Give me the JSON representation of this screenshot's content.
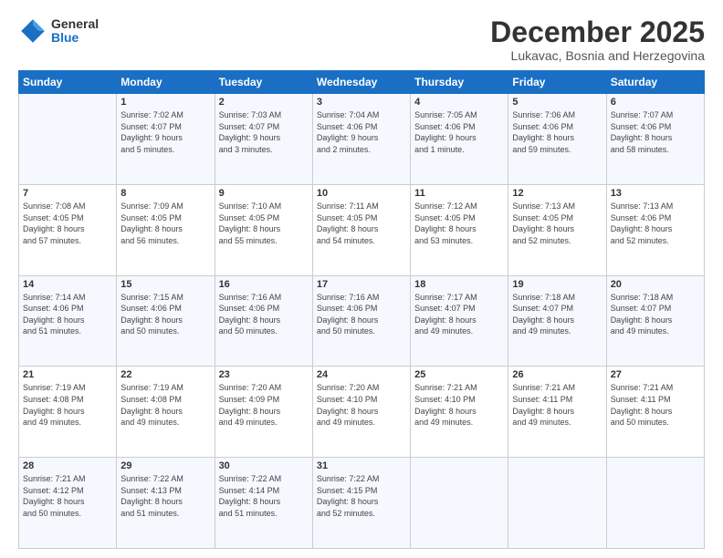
{
  "logo": {
    "general": "General",
    "blue": "Blue"
  },
  "title": "December 2025",
  "subtitle": "Lukavac, Bosnia and Herzegovina",
  "days": [
    "Sunday",
    "Monday",
    "Tuesday",
    "Wednesday",
    "Thursday",
    "Friday",
    "Saturday"
  ],
  "weeks": [
    [
      {
        "num": "",
        "info": ""
      },
      {
        "num": "1",
        "info": "Sunrise: 7:02 AM\nSunset: 4:07 PM\nDaylight: 9 hours\nand 5 minutes."
      },
      {
        "num": "2",
        "info": "Sunrise: 7:03 AM\nSunset: 4:07 PM\nDaylight: 9 hours\nand 3 minutes."
      },
      {
        "num": "3",
        "info": "Sunrise: 7:04 AM\nSunset: 4:06 PM\nDaylight: 9 hours\nand 2 minutes."
      },
      {
        "num": "4",
        "info": "Sunrise: 7:05 AM\nSunset: 4:06 PM\nDaylight: 9 hours\nand 1 minute."
      },
      {
        "num": "5",
        "info": "Sunrise: 7:06 AM\nSunset: 4:06 PM\nDaylight: 8 hours\nand 59 minutes."
      },
      {
        "num": "6",
        "info": "Sunrise: 7:07 AM\nSunset: 4:06 PM\nDaylight: 8 hours\nand 58 minutes."
      }
    ],
    [
      {
        "num": "7",
        "info": "Sunrise: 7:08 AM\nSunset: 4:05 PM\nDaylight: 8 hours\nand 57 minutes."
      },
      {
        "num": "8",
        "info": "Sunrise: 7:09 AM\nSunset: 4:05 PM\nDaylight: 8 hours\nand 56 minutes."
      },
      {
        "num": "9",
        "info": "Sunrise: 7:10 AM\nSunset: 4:05 PM\nDaylight: 8 hours\nand 55 minutes."
      },
      {
        "num": "10",
        "info": "Sunrise: 7:11 AM\nSunset: 4:05 PM\nDaylight: 8 hours\nand 54 minutes."
      },
      {
        "num": "11",
        "info": "Sunrise: 7:12 AM\nSunset: 4:05 PM\nDaylight: 8 hours\nand 53 minutes."
      },
      {
        "num": "12",
        "info": "Sunrise: 7:13 AM\nSunset: 4:05 PM\nDaylight: 8 hours\nand 52 minutes."
      },
      {
        "num": "13",
        "info": "Sunrise: 7:13 AM\nSunset: 4:06 PM\nDaylight: 8 hours\nand 52 minutes."
      }
    ],
    [
      {
        "num": "14",
        "info": "Sunrise: 7:14 AM\nSunset: 4:06 PM\nDaylight: 8 hours\nand 51 minutes."
      },
      {
        "num": "15",
        "info": "Sunrise: 7:15 AM\nSunset: 4:06 PM\nDaylight: 8 hours\nand 50 minutes."
      },
      {
        "num": "16",
        "info": "Sunrise: 7:16 AM\nSunset: 4:06 PM\nDaylight: 8 hours\nand 50 minutes."
      },
      {
        "num": "17",
        "info": "Sunrise: 7:16 AM\nSunset: 4:06 PM\nDaylight: 8 hours\nand 50 minutes."
      },
      {
        "num": "18",
        "info": "Sunrise: 7:17 AM\nSunset: 4:07 PM\nDaylight: 8 hours\nand 49 minutes."
      },
      {
        "num": "19",
        "info": "Sunrise: 7:18 AM\nSunset: 4:07 PM\nDaylight: 8 hours\nand 49 minutes."
      },
      {
        "num": "20",
        "info": "Sunrise: 7:18 AM\nSunset: 4:07 PM\nDaylight: 8 hours\nand 49 minutes."
      }
    ],
    [
      {
        "num": "21",
        "info": "Sunrise: 7:19 AM\nSunset: 4:08 PM\nDaylight: 8 hours\nand 49 minutes."
      },
      {
        "num": "22",
        "info": "Sunrise: 7:19 AM\nSunset: 4:08 PM\nDaylight: 8 hours\nand 49 minutes."
      },
      {
        "num": "23",
        "info": "Sunrise: 7:20 AM\nSunset: 4:09 PM\nDaylight: 8 hours\nand 49 minutes."
      },
      {
        "num": "24",
        "info": "Sunrise: 7:20 AM\nSunset: 4:10 PM\nDaylight: 8 hours\nand 49 minutes."
      },
      {
        "num": "25",
        "info": "Sunrise: 7:21 AM\nSunset: 4:10 PM\nDaylight: 8 hours\nand 49 minutes."
      },
      {
        "num": "26",
        "info": "Sunrise: 7:21 AM\nSunset: 4:11 PM\nDaylight: 8 hours\nand 49 minutes."
      },
      {
        "num": "27",
        "info": "Sunrise: 7:21 AM\nSunset: 4:11 PM\nDaylight: 8 hours\nand 50 minutes."
      }
    ],
    [
      {
        "num": "28",
        "info": "Sunrise: 7:21 AM\nSunset: 4:12 PM\nDaylight: 8 hours\nand 50 minutes."
      },
      {
        "num": "29",
        "info": "Sunrise: 7:22 AM\nSunset: 4:13 PM\nDaylight: 8 hours\nand 51 minutes."
      },
      {
        "num": "30",
        "info": "Sunrise: 7:22 AM\nSunset: 4:14 PM\nDaylight: 8 hours\nand 51 minutes."
      },
      {
        "num": "31",
        "info": "Sunrise: 7:22 AM\nSunset: 4:15 PM\nDaylight: 8 hours\nand 52 minutes."
      },
      {
        "num": "",
        "info": ""
      },
      {
        "num": "",
        "info": ""
      },
      {
        "num": "",
        "info": ""
      }
    ]
  ]
}
